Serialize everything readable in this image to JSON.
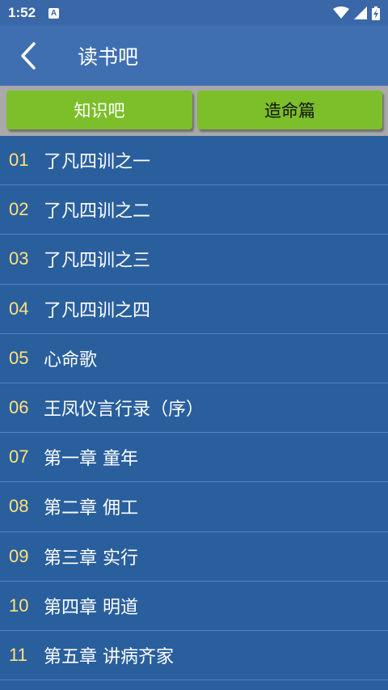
{
  "status_bar": {
    "time": "1:52",
    "badge": "A"
  },
  "app_bar": {
    "title": "读书吧"
  },
  "tabs": [
    {
      "label": "知识吧"
    },
    {
      "label": "造命篇"
    }
  ],
  "list": {
    "items": [
      {
        "num": "01",
        "title": "了凡四训之一"
      },
      {
        "num": "02",
        "title": "了凡四训之二"
      },
      {
        "num": "03",
        "title": "了凡四训之三"
      },
      {
        "num": "04",
        "title": "了凡四训之四"
      },
      {
        "num": "05",
        "title": "心命歌"
      },
      {
        "num": "06",
        "title": "王凤仪言行录（序）"
      },
      {
        "num": "07",
        "title": "第一章 童年"
      },
      {
        "num": "08",
        "title": "第二章 佣工"
      },
      {
        "num": "09",
        "title": "第三章 实行"
      },
      {
        "num": "10",
        "title": "第四章 明道"
      },
      {
        "num": "11",
        "title": "第五章 讲病齐家"
      }
    ]
  }
}
